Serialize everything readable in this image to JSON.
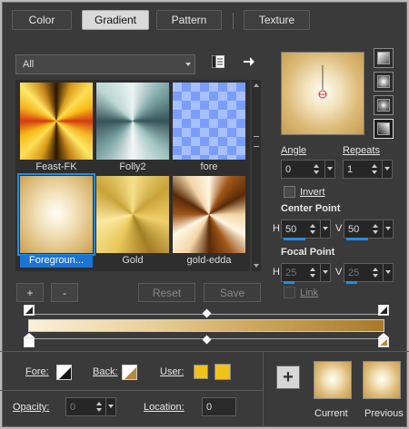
{
  "tabs": [
    {
      "label": "Color"
    },
    {
      "label": "Gradient"
    },
    {
      "label": "Pattern"
    },
    {
      "label": "Texture"
    }
  ],
  "library": {
    "selected": "All"
  },
  "swatches": [
    {
      "name": "Feast-FK"
    },
    {
      "name": "Folly2"
    },
    {
      "name": "fore"
    },
    {
      "name": "Foregroun..."
    },
    {
      "name": "Gold"
    },
    {
      "name": "gold-edda"
    }
  ],
  "angle": {
    "label": "Angle",
    "value": "0"
  },
  "repeats": {
    "label": "Repeats",
    "value": "1"
  },
  "invert": {
    "label": "Invert"
  },
  "center_point": {
    "label": "Center Point",
    "h_label": "H",
    "h_value": "50",
    "v_label": "V",
    "v_value": "50"
  },
  "focal_point": {
    "label": "Focal Point",
    "h_label": "H",
    "h_value": "25",
    "v_label": "V",
    "v_value": "25"
  },
  "link": {
    "label": "Link"
  },
  "buttons": {
    "add": "+",
    "remove": "-",
    "reset": "Reset",
    "save": "Save"
  },
  "bottom": {
    "fore_label": "Fore:",
    "back_label": "Back:",
    "user_label": "User:",
    "opacity_label": "Opacity:",
    "opacity_value": "0",
    "location_label": "Location:",
    "location_value": "0",
    "current_label": "Current",
    "previous_label": "Previous"
  },
  "colors": {
    "accent": "#1e8fe6",
    "user_swatch": "#f1c21c"
  }
}
